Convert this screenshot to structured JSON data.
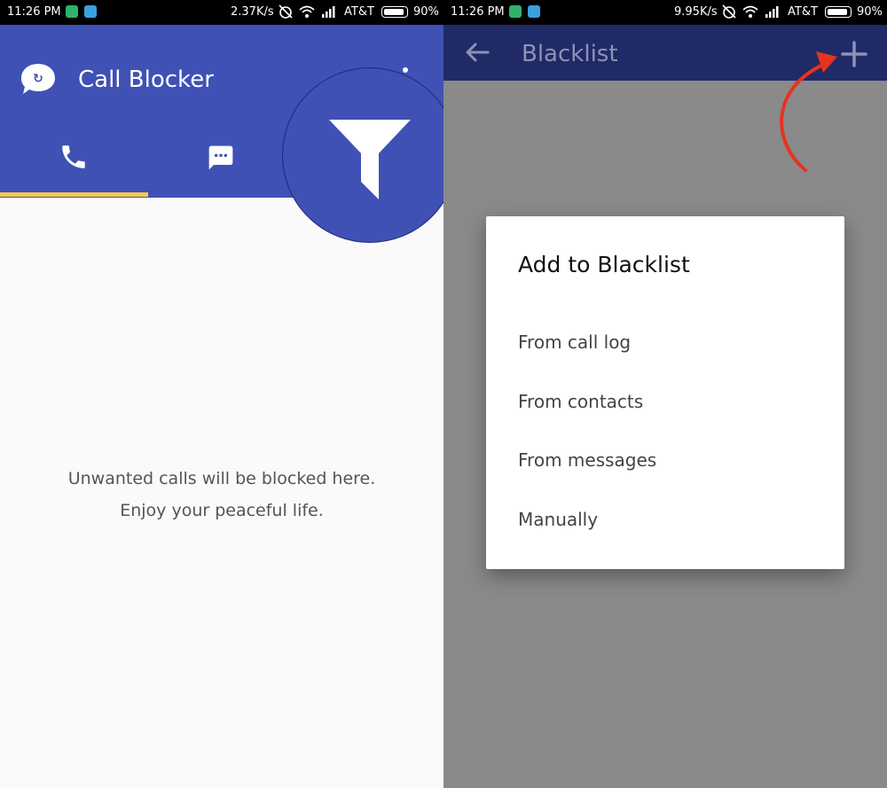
{
  "left": {
    "status": {
      "time": "11:26 PM",
      "speed": "2.37K/s",
      "carrier": "AT&T",
      "battery": "90%"
    },
    "app_title": "Call Blocker",
    "tabs": [
      {
        "icon": "phone-icon"
      },
      {
        "icon": "message-icon"
      },
      {
        "icon": "filter-icon"
      }
    ],
    "empty_state": {
      "line1": "Unwanted calls will be blocked here.",
      "line2": "Enjoy your peaceful life."
    }
  },
  "right": {
    "status": {
      "time": "11:26 PM",
      "speed": "9.95K/s",
      "carrier": "AT&T",
      "battery": "90%"
    },
    "title": "Blacklist",
    "dialog": {
      "title": "Add to Blacklist",
      "options": [
        "From call log",
        "From contacts",
        "From messages",
        "Manually"
      ]
    }
  },
  "colors": {
    "primary": "#3f51b5",
    "accent": "#f2c94c",
    "annotation": "#e8321e"
  }
}
